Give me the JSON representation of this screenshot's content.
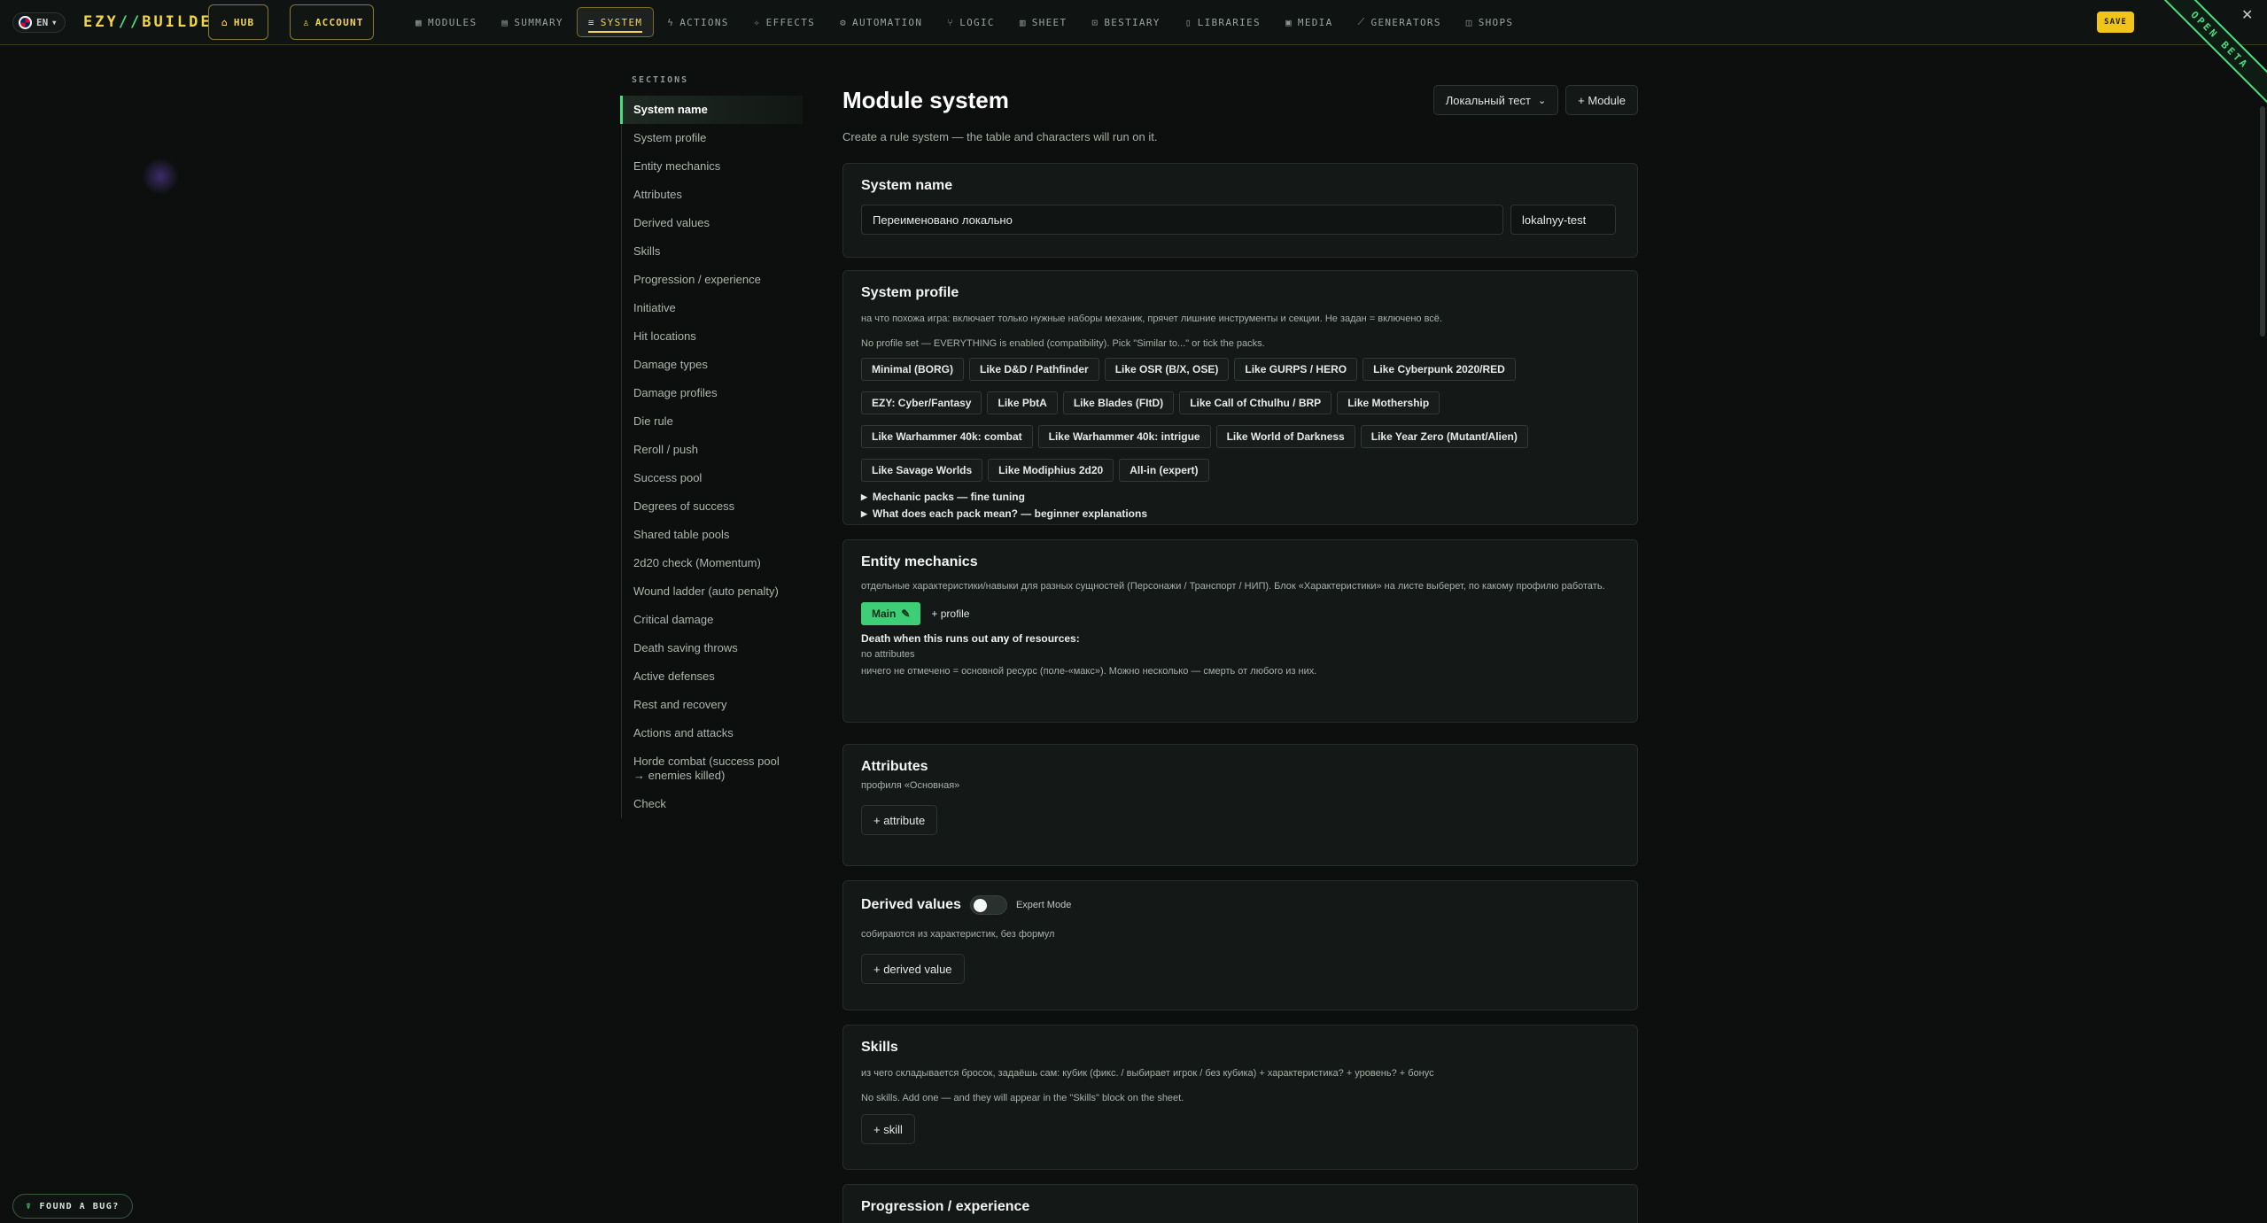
{
  "topbar": {
    "lang": "EN",
    "brand_left": "EZY",
    "brand_slash": "//",
    "brand_right": "BUILDER",
    "hub": "HUB",
    "account": "ACCOUNT",
    "nav": [
      {
        "label": "MODULES",
        "icon": "grid-icon"
      },
      {
        "label": "SUMMARY",
        "icon": "document-icon"
      },
      {
        "label": "SYSTEM",
        "icon": "sliders-icon",
        "active": true
      },
      {
        "label": "ACTIONS",
        "icon": "bolt-icon"
      },
      {
        "label": "EFFECTS",
        "icon": "sparkle-icon"
      },
      {
        "label": "AUTOMATION",
        "icon": "gear-icon"
      },
      {
        "label": "LOGIC",
        "icon": "branch-icon"
      },
      {
        "label": "SHEET",
        "icon": "sheet-icon"
      },
      {
        "label": "BESTIARY",
        "icon": "lock-icon"
      },
      {
        "label": "LIBRARIES",
        "icon": "book-icon"
      },
      {
        "label": "MEDIA",
        "icon": "image-icon"
      },
      {
        "label": "GENERATORS",
        "icon": "wand-icon"
      },
      {
        "label": "SHOPS",
        "icon": "bag-icon"
      }
    ],
    "save": "SAVE",
    "ribbon": "OPEN BETA",
    "accent": "#f2d55c",
    "green": "#4ade80"
  },
  "sections": {
    "title": "SECTIONS",
    "items": [
      "System name",
      "System profile",
      "Entity mechanics",
      "Attributes",
      "Derived values",
      "Skills",
      "Progression / experience",
      "Initiative",
      "Hit locations",
      "Damage types",
      "Damage profiles",
      "Die rule",
      "Reroll / push",
      "Success pool",
      "Degrees of success",
      "Shared table pools",
      "2d20 check (Momentum)",
      "Wound ladder (auto penalty)",
      "Critical damage",
      "Death saving throws",
      "Active defenses",
      "Rest and recovery",
      "Actions and attacks",
      "Horde combat (success pool → enemies killed)",
      "Check"
    ]
  },
  "main": {
    "title": "Module system",
    "subtitle": "Create a rule system — the table and characters will run on it.",
    "local_test": "Локальный тест",
    "add_module": "+ Module"
  },
  "system_name": {
    "heading": "System name",
    "name_value": "Переименовано локально",
    "slug_value": "lokalnyy-test"
  },
  "system_profile": {
    "heading": "System profile",
    "hint1": "на что похожа игра: включает только нужные наборы механик, прячет лишние инструменты и секции. Не задан = включено всё.",
    "hint2": "No profile set — EVERYTHING is enabled (compatibility). Pick \"Similar to...\" or tick the packs.",
    "chips": [
      "Minimal (BORG)",
      "Like D&D / Pathfinder",
      "Like OSR (B/X, OSE)",
      "Like GURPS / HERO",
      "Like Cyberpunk 2020/RED",
      "EZY: Cyber/Fantasy",
      "Like PbtA",
      "Like Blades (FItD)",
      "Like Call of Cthulhu / BRP",
      "Like Mothership",
      "Like Warhammer 40k: combat",
      "Like Warhammer 40k: intrigue",
      "Like World of Darkness",
      "Like Year Zero (Mutant/Alien)",
      "Like Savage Worlds",
      "Like Modiphius 2d20",
      "All-in (expert)"
    ],
    "details1": "Mechanic packs — fine tuning",
    "details2": "What does each pack mean? — beginner explanations"
  },
  "entity_mechanics": {
    "heading": "Entity mechanics",
    "hint": "отдельные характеристики/навыки для разных сущностей (Персонажи / Транспорт / НИП). Блок «Характеристики» на листе выберет, по какому профилю работать.",
    "main_tab": "Main",
    "add_profile": "+ profile",
    "death_pre": "Death when this runs out ",
    "death_any": "any",
    "death_post": " of resources:",
    "no_attributes": "no attributes",
    "note": "ничего не отмечено = основной ресурс (поле-«макс»). Можно несколько — смерть от любого из них."
  },
  "attributes": {
    "heading": "Attributes",
    "hint": "профиля «Основная»",
    "add": "+ attribute"
  },
  "derived_values": {
    "heading": "Derived values",
    "expert_mode": "Expert Mode",
    "hint": "собираются из характеристик, без формул",
    "add": "+ derived value"
  },
  "skills": {
    "heading": "Skills",
    "hint1": "из чего складывается бросок, задаёшь сам: кубик (фикс. / выбирает игрок / без кубика) + характеристика? + уровень? + бонус",
    "hint2": "No skills. Add one — and they will appear in the \"Skills\" block on the sheet.",
    "add": "+ skill"
  },
  "progression": {
    "heading": "Progression / experience"
  },
  "bug": {
    "label": "FOUND A BUG?"
  }
}
